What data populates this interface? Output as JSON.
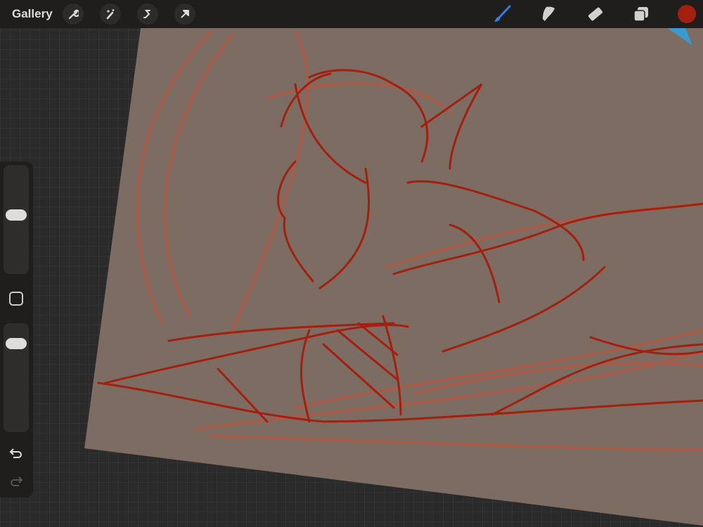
{
  "toolbar": {
    "gallery_label": "Gallery",
    "left_tools": [
      "wrench-icon",
      "magic-wand-icon",
      "selection-icon",
      "transform-arrow-icon"
    ],
    "right_tools": [
      "brush-icon",
      "smudge-icon",
      "eraser-icon",
      "layers-icon"
    ],
    "active_tool": "brush",
    "brush_color": "#2f7fe0",
    "current_color": "#a3200f"
  },
  "sidebar": {
    "brush_size_fraction": 0.55,
    "opacity_fraction": 0.85
  },
  "canvas": {
    "background": "#7d6c62",
    "sketch_color": "#a3200f",
    "underlay_color": "#b9553f"
  }
}
